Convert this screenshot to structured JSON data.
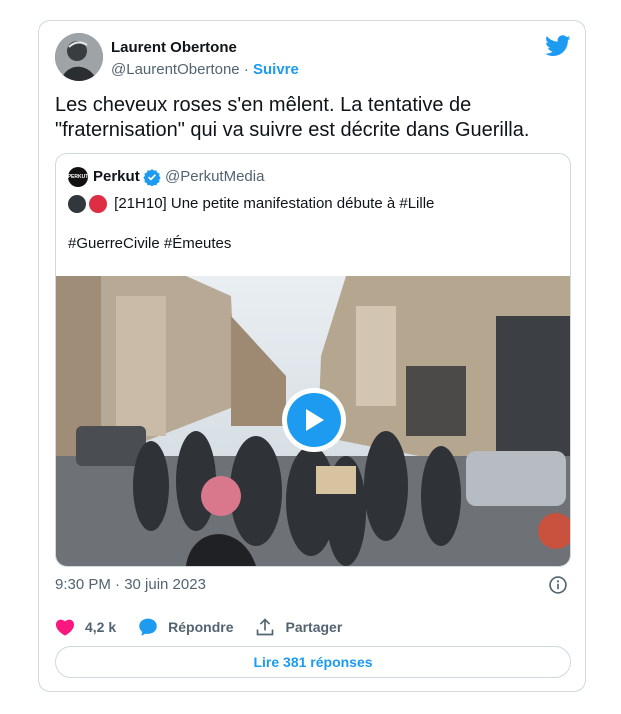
{
  "tweet": {
    "author_name": "Laurent Obertone",
    "author_handle": "@LaurentObertone",
    "separator": " · ",
    "follow_label": "Suivre",
    "text_line1": "Les cheveux roses s'en mêlent. La tentative de",
    "text_line2": "\"fraternisation\" qui va suivre est décrite dans Guerilla.",
    "timestamp": "9:30 PM · 30 juin 2023",
    "brand_icon": "twitter-bird-icon",
    "accent_color": "#1d9bf0"
  },
  "quote": {
    "avatar_text": "PERKUT",
    "name": "Perkut",
    "verified_icon": "verified-badge-icon",
    "handle": "@PerkutMedia",
    "line1": "[21H10] Une petite manifestation débute à #Lille",
    "line2": "#GuerreCivile #Émeutes",
    "media_icon": "play-icon"
  },
  "actions": {
    "like_count": "4,2 k",
    "reply_label": "Répondre",
    "share_label": "Partager",
    "like_color": "#f91880"
  },
  "footer": {
    "read_replies_label": "Lire 381 réponses"
  }
}
